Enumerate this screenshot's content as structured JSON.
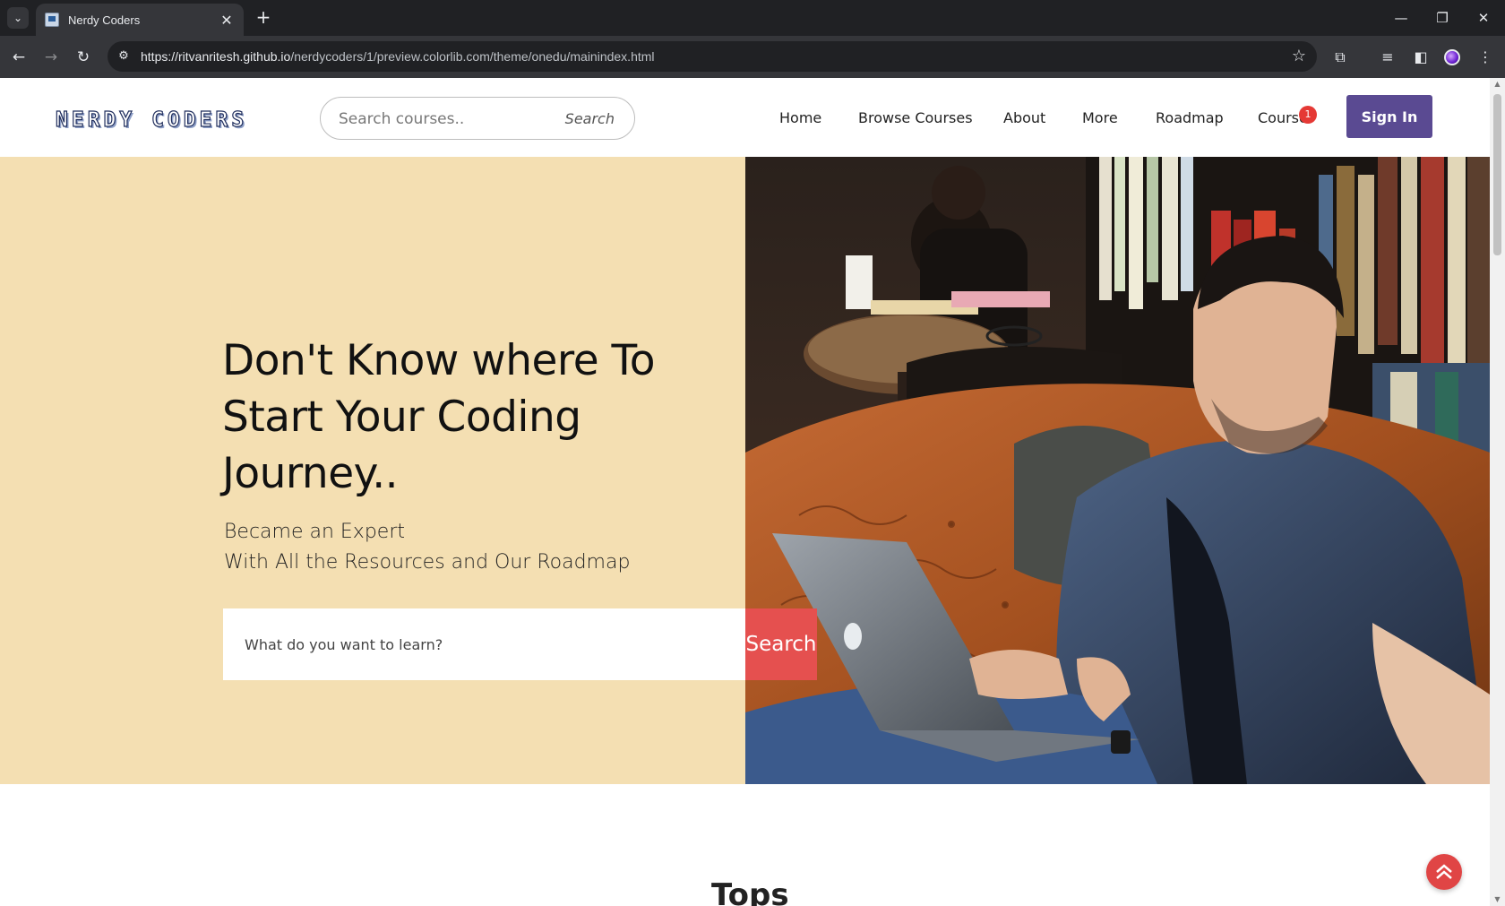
{
  "browser": {
    "tab_title": "Nerdy Coders",
    "tab_close": "✕",
    "new_tab": "+",
    "url_host": "https://ritvanritesh.github.io",
    "url_path": "/nerdycoders/1/preview.colorlib.com/theme/onedu/mainindex.html"
  },
  "header": {
    "logo": "NERDY CODERS",
    "search_placeholder": "Search courses..",
    "search_button": "Search",
    "nav": [
      "Home",
      "Browse Courses",
      "About",
      "More",
      "Roadmap",
      "Course"
    ],
    "cart_count": "1",
    "signin": "Sign In"
  },
  "hero": {
    "title": "Don't Know where To Start Your Coding Journey..",
    "subtitle_line1": "Became an Expert",
    "subtitle_line2": "With All the Resources and Our Roadmap",
    "search_placeholder": "What do you want to learn?",
    "search_button": "Search"
  },
  "section": {
    "title": "Tops"
  },
  "colors": {
    "hero_bg": "#f4dfb2",
    "signin_bg": "#5a4a92",
    "search_btn": "#e5504f",
    "badge": "#e53935"
  }
}
